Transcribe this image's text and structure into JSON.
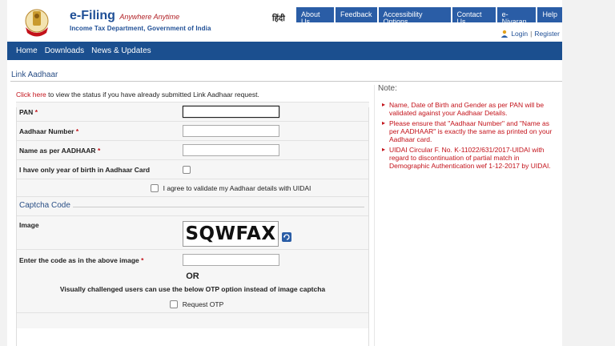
{
  "header": {
    "brand_title": "e-Filing",
    "brand_tagline": "Anywhere Anytime",
    "brand_subtitle": "Income Tax Department, Government of India",
    "language": "हिंदी",
    "top_nav": [
      "About Us",
      "Feedback",
      "Accessibility Options",
      "Contact Us",
      "e-Nivaran",
      "Help"
    ],
    "login": "Login",
    "register": "Register",
    "separator": "|"
  },
  "main_nav": [
    "Home",
    "Downloads",
    "News & Updates"
  ],
  "page_title": "Link Aadhaar",
  "form": {
    "status_link": "Click here",
    "status_text": " to view the status if you have already submitted Link Aadhaar request.",
    "pan_label": "PAN",
    "aadhaar_label": "Aadhaar Number",
    "name_label": "Name as per AADHAAR",
    "yob_label": "I have only year of birth in Aadhaar Card",
    "agree_label": "I agree to validate my Aadhaar details with UIDAI",
    "required_mark": "*",
    "pan_value": "",
    "aadhaar_value": "",
    "name_value": "",
    "captcha_section": "Captcha Code",
    "image_label": "Image",
    "captcha_text": "SQWFAX",
    "code_label": "Enter the code as in the above image",
    "code_value": "",
    "or_text": "OR",
    "vi_text": "Visually challenged users can use the below OTP option instead of image captcha",
    "otp_label": "Request OTP"
  },
  "notes": {
    "title": "Note:",
    "items": [
      "Name, Date of Birth and Gender as per PAN will be validated against your Aadhaar Details.",
      "Please ensure that \"Aadhaar Number\" and \"Name as per AADHAAR\" is exactly the same as printed on your Aadhaar card.",
      "UIDAI Circular F. No. K-11022/631/2017-UIDAI with regard to discontinuation of partial match in Demographic Authentication wef 1-12-2017 by UIDAI."
    ]
  },
  "colors": {
    "nav_bg": "#1b4f8f",
    "button_bg": "#2a5da6",
    "brand_blue": "#1f4f96",
    "alert_red": "#c3121a"
  },
  "icons": {
    "logo": "emblem-icon",
    "login": "user-icon",
    "refresh": "refresh-icon"
  }
}
